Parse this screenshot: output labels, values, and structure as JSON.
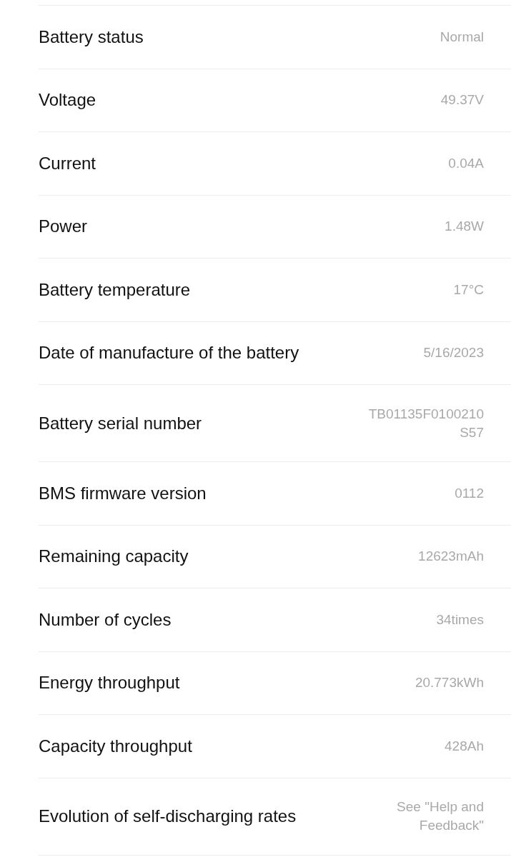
{
  "rows": [
    {
      "label": "Battery status",
      "value": "Normal"
    },
    {
      "label": "Voltage",
      "value": "49.37V"
    },
    {
      "label": "Current",
      "value": "0.04A"
    },
    {
      "label": "Power",
      "value": "1.48W"
    },
    {
      "label": "Battery temperature",
      "value": "17°C"
    },
    {
      "label": "Date of manufacture of the battery",
      "value": "5/16/2023"
    },
    {
      "label": "Battery serial number",
      "value": "TB01135F0100210S57"
    },
    {
      "label": "BMS firmware version",
      "value": "0112"
    },
    {
      "label": "Remaining capacity",
      "value": "12623mAh"
    },
    {
      "label": "Number of cycles",
      "value": "34times"
    },
    {
      "label": "Energy throughput",
      "value": "20.773kWh"
    },
    {
      "label": "Capacity throughput",
      "value": "428Ah"
    },
    {
      "label": "Evolution of self-discharging rates",
      "value": "See \"Help and Feedback\""
    }
  ]
}
